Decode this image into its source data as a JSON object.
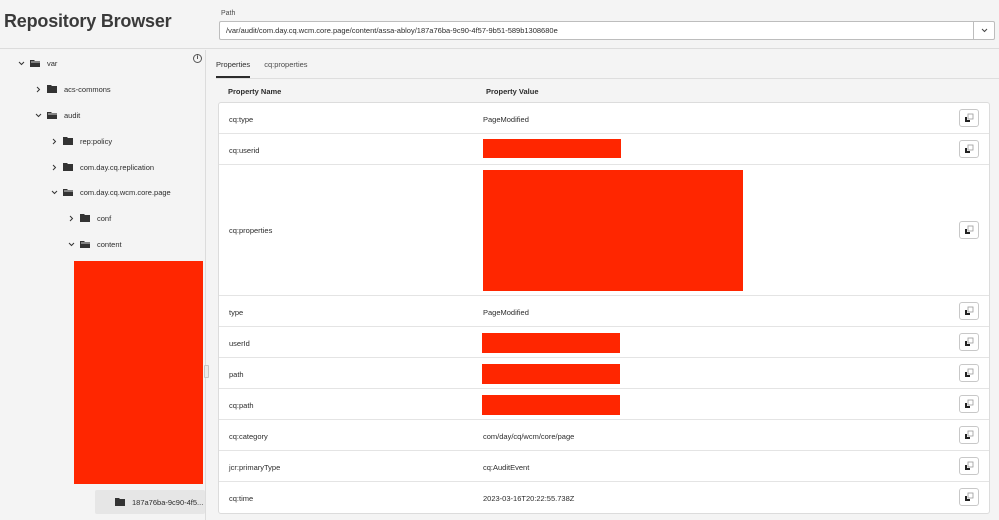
{
  "app": {
    "title": "Repository Browser"
  },
  "path": {
    "label": "Path",
    "value": "/var/audit/com.day.cq.wcm.core.page/content/assa-abloy/187a76ba-9c90-4f57-9b51-589b1308680e",
    "dropdown_icon": "chevron-down-icon"
  },
  "sidebar": {
    "info_icon": "info-icon",
    "tree": [
      {
        "label": "var",
        "state": "expanded",
        "depth": 0
      },
      {
        "label": "acs-commons",
        "state": "collapsed",
        "depth": 1
      },
      {
        "label": "audit",
        "state": "expanded",
        "depth": 1
      },
      {
        "label": "rep:policy",
        "state": "collapsed",
        "depth": 2
      },
      {
        "label": "com.day.cq.replication",
        "state": "collapsed",
        "depth": 2
      },
      {
        "label": "com.day.cq.wcm.core.page",
        "state": "expanded",
        "depth": 2
      },
      {
        "label": "conf",
        "state": "collapsed",
        "depth": 3
      },
      {
        "label": "content",
        "state": "expanded",
        "depth": 3
      },
      {
        "label": "[redacted]",
        "state": "redacted",
        "depth": 4
      },
      {
        "label": "187a76ba-9c90-4f5...",
        "state": "selected",
        "depth": 5
      }
    ]
  },
  "main": {
    "tabs": [
      {
        "label": "Properties",
        "active": true
      },
      {
        "label": "cq:properties",
        "active": false
      }
    ],
    "table": {
      "headers": {
        "name": "Property Name",
        "value": "Property Value"
      },
      "rows": [
        {
          "name": "cq:type",
          "value": "PageModified",
          "redacted": false
        },
        {
          "name": "cq:userid",
          "value": "",
          "redacted": true
        },
        {
          "name": "cq:properties",
          "value": "",
          "redacted": true
        },
        {
          "name": "type",
          "value": "PageModified",
          "redacted": false
        },
        {
          "name": "userId",
          "value": "",
          "redacted": true
        },
        {
          "name": "path",
          "value": "",
          "redacted": true
        },
        {
          "name": "cq:path",
          "value": "",
          "redacted": true
        },
        {
          "name": "cq:category",
          "value": "com/day/cq/wcm/core/page",
          "redacted": false
        },
        {
          "name": "jcr:primaryType",
          "value": "cq:AuditEvent",
          "redacted": false
        },
        {
          "name": "cq:time",
          "value": "2023-03-16T20:22:55.738Z",
          "redacted": false
        }
      ],
      "row_action_icon": "copy-icon"
    }
  },
  "colors": {
    "redaction": "#ff2600",
    "background": "#f4f4f4",
    "text": "#2c2c2c"
  }
}
